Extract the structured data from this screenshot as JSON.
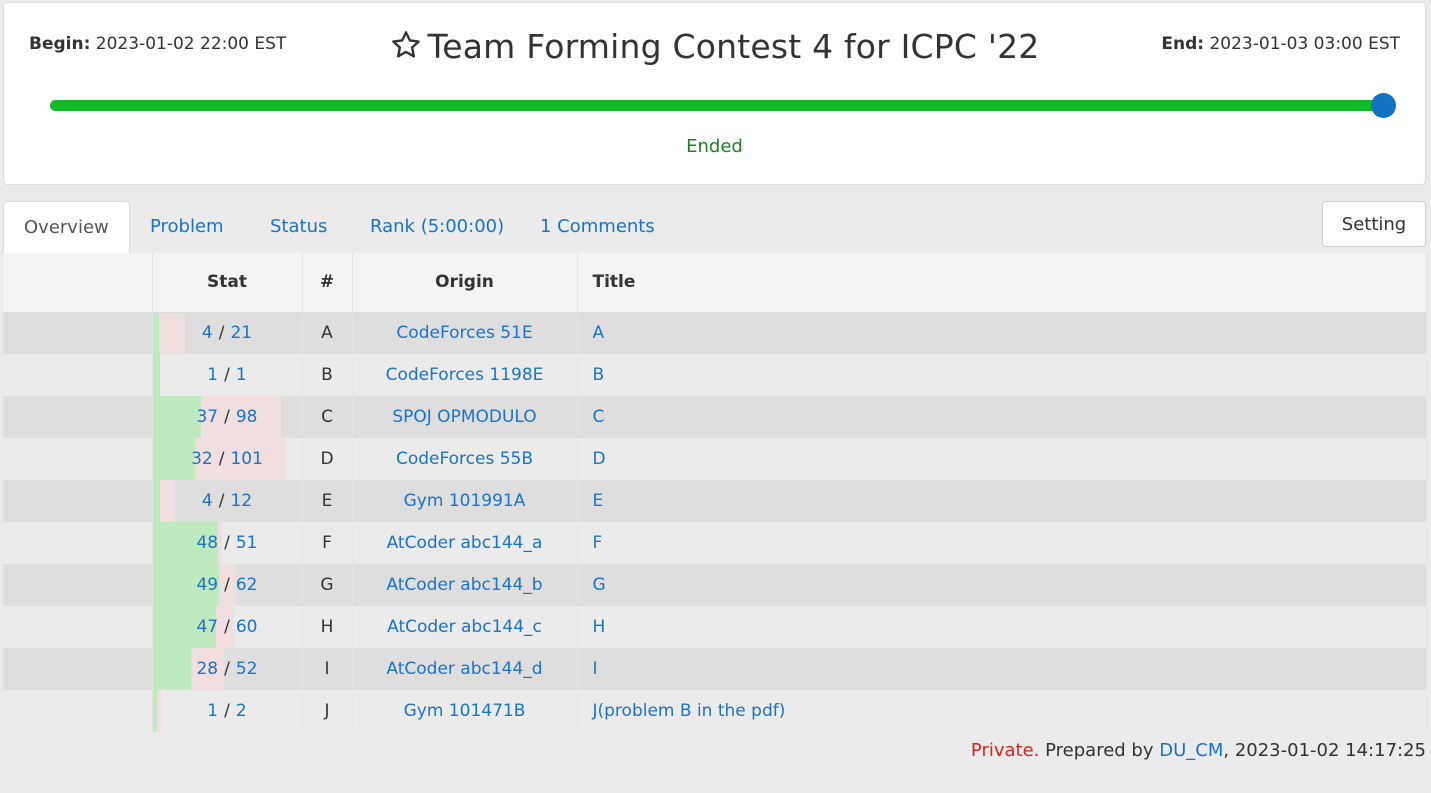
{
  "contest": {
    "begin_label": "Begin:",
    "begin_value": "2023-01-02 22:00 EST",
    "end_label": "End:",
    "end_value": "2023-01-03 03:00 EST",
    "title": "Team Forming Contest 4 for ICPC '22",
    "title_icon": "star-outline-icon",
    "progress": 1.0,
    "status": "Ended",
    "colors": {
      "progress": "#13b927",
      "knob": "#1372c4",
      "status": "#1f7e1f"
    }
  },
  "tabs": [
    {
      "label": "Overview",
      "active": true
    },
    {
      "label": "Problem",
      "active": false
    },
    {
      "label": "Status",
      "active": false
    },
    {
      "label": "Rank (5:00:00)",
      "active": false
    },
    {
      "label": "1 Comments",
      "active": false
    }
  ],
  "setting_label": "Setting",
  "table": {
    "headers": {
      "stat": "Stat",
      "num": "#",
      "origin": "Origin",
      "title": "Title"
    },
    "rows": [
      {
        "ac": "4",
        "total": "21",
        "num": "A",
        "origin": "CodeForces 51E",
        "title": "A"
      },
      {
        "ac": "1",
        "total": "1",
        "num": "B",
        "origin": "CodeForces 1198E",
        "title": "B"
      },
      {
        "ac": "37",
        "total": "98",
        "num": "C",
        "origin": "SPOJ OPMODULO",
        "title": "C"
      },
      {
        "ac": "32",
        "total": "101",
        "num": "D",
        "origin": "CodeForces 55B",
        "title": "D"
      },
      {
        "ac": "4",
        "total": "12",
        "num": "E",
        "origin": "Gym 101991A",
        "title": "E"
      },
      {
        "ac": "48",
        "total": "51",
        "num": "F",
        "origin": "AtCoder abc144_a",
        "title": "F"
      },
      {
        "ac": "49",
        "total": "62",
        "num": "G",
        "origin": "AtCoder abc144_b",
        "title": "G"
      },
      {
        "ac": "47",
        "total": "60",
        "num": "H",
        "origin": "AtCoder abc144_c",
        "title": "H"
      },
      {
        "ac": "28",
        "total": "52",
        "num": "I",
        "origin": "AtCoder abc144_d",
        "title": "I"
      },
      {
        "ac": "1",
        "total": "2",
        "num": "J",
        "origin": "Gym 101471B",
        "title": "J(problem B in the pdf)"
      }
    ]
  },
  "footer": {
    "private": "Private.",
    "prepared_by": " Prepared by ",
    "author": "DU_CM",
    "timestamp": ", 2023-01-02 14:17:25"
  }
}
